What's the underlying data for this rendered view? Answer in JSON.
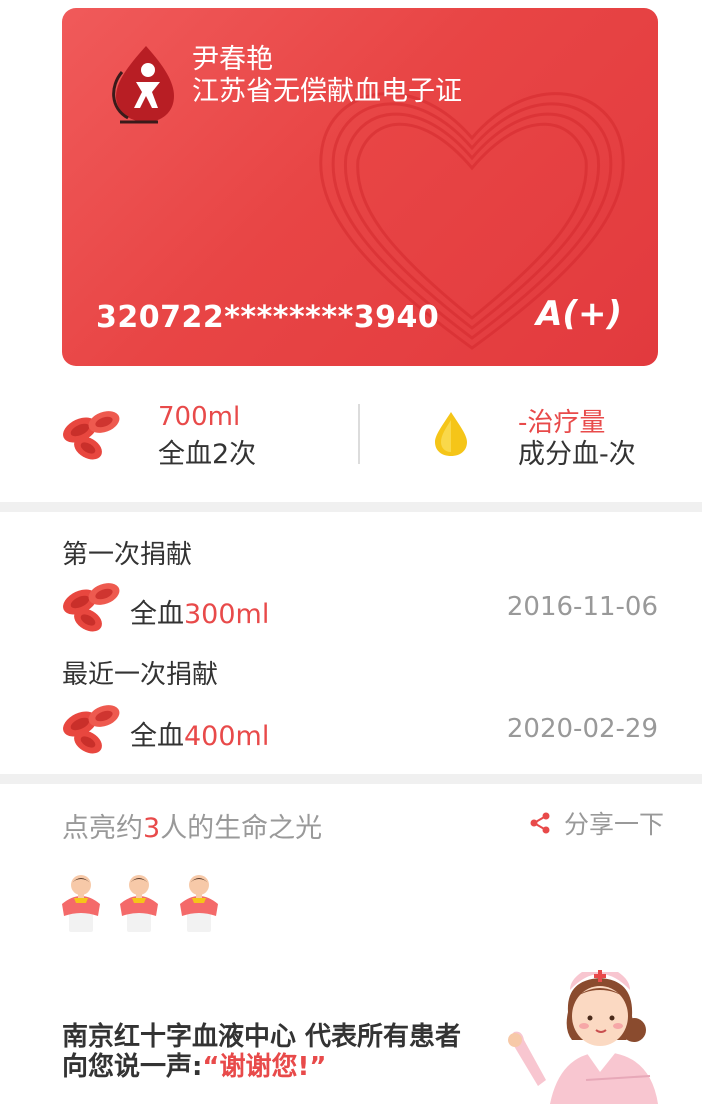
{
  "card": {
    "name": "尹春艳",
    "title": "江苏省无偿献血电子证",
    "id_number": "320722********3940",
    "blood_type": "A(+)",
    "logo_icon": "blood-drop-person-logo",
    "background_icon": "heart-ribbon"
  },
  "stats": {
    "whole_blood": {
      "volume": "700ml",
      "label": "全血2次",
      "icon": "red-blood-cells-icon"
    },
    "component": {
      "volume": "-治疗量",
      "label": "成分血-次",
      "icon": "yellow-drop-icon"
    }
  },
  "records": {
    "first": {
      "heading": "第一次捐献",
      "prefix": "全血",
      "volume": "300ml",
      "date": "2016-11-06"
    },
    "latest": {
      "heading": "最近一次捐献",
      "prefix": "全血",
      "volume": "400ml",
      "date": "2020-02-29"
    }
  },
  "impact": {
    "text_before": "点亮约",
    "count": "3",
    "text_after": "人的生命之光",
    "share_label": "分享一下",
    "people_count": 3
  },
  "thanks": {
    "line1": "南京红十字血液中心 代表所有患者",
    "line2_prefix": "向您说一声:",
    "line2_quote": "“谢谢您!”"
  },
  "colors": {
    "accent": "#e84a4a",
    "card": "#e84545",
    "gold": "#f5c518"
  }
}
